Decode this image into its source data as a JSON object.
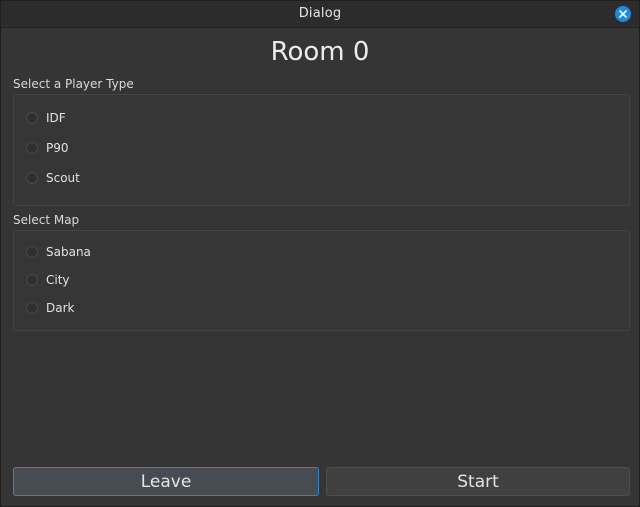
{
  "window": {
    "title": "Dialog",
    "close_icon": "close-icon",
    "accent": "#1e88e5"
  },
  "room": {
    "title": "Room 0"
  },
  "player_type": {
    "label": "Select a Player Type",
    "options": [
      {
        "label": "IDF",
        "selected": false
      },
      {
        "label": "P90",
        "selected": false
      },
      {
        "label": "Scout",
        "selected": false
      }
    ]
  },
  "map": {
    "label": "Select Map",
    "options": [
      {
        "label": "Sabana",
        "selected": false
      },
      {
        "label": "City",
        "selected": false
      },
      {
        "label": "Dark",
        "selected": false
      }
    ]
  },
  "buttons": {
    "leave": "Leave",
    "start": "Start"
  }
}
